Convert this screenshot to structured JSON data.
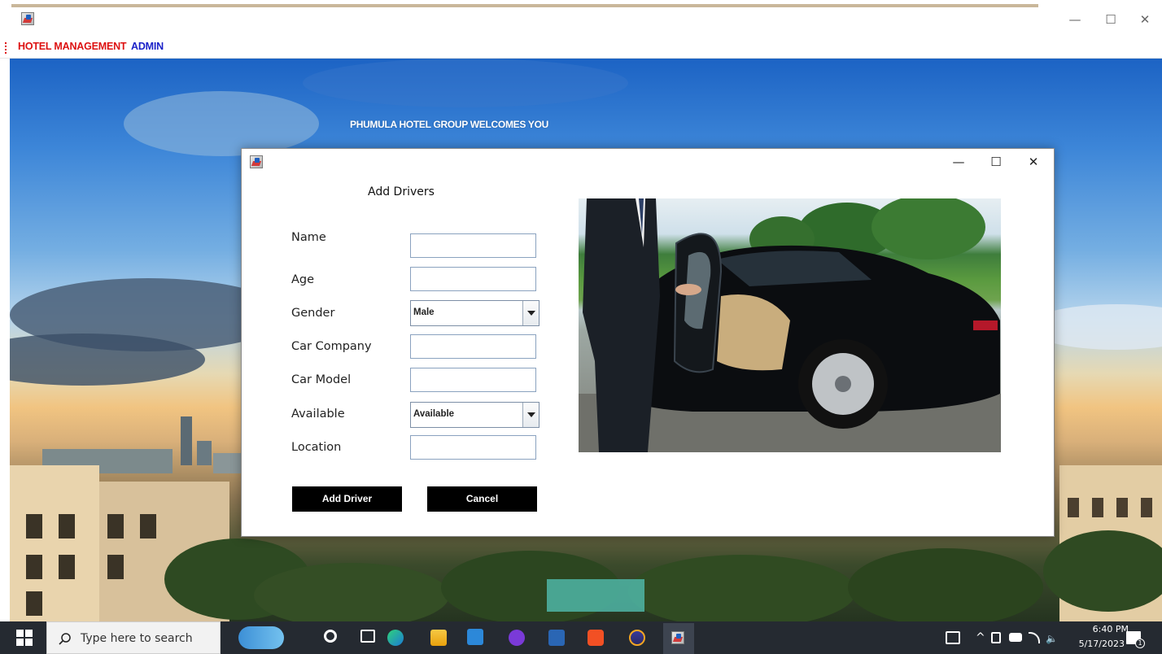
{
  "menubar": {
    "hotel_management": "HOTEL MANAGEMENT",
    "admin": "ADMIN"
  },
  "main": {
    "welcome": "PHUMULA HOTEL GROUP WELCOMES YOU"
  },
  "dialog": {
    "title": "Add Drivers",
    "fields": [
      {
        "label": "Name",
        "value": ""
      },
      {
        "label": "Age",
        "value": ""
      },
      {
        "label": "Gender",
        "value": "Male"
      },
      {
        "label": "Car Company",
        "value": ""
      },
      {
        "label": "Car Model",
        "value": ""
      },
      {
        "label": "Available",
        "value": "Available"
      },
      {
        "label": "Location",
        "value": ""
      }
    ],
    "buttons": {
      "add": "Add Driver",
      "cancel": "Cancel"
    }
  },
  "taskbar": {
    "search_placeholder": "Type here to search",
    "time": "6:40 PM",
    "date": "5/17/2023",
    "notification_count": "1"
  },
  "icons": [
    "app-icon",
    "minimize-icon",
    "maximize-icon",
    "close-icon",
    "windows-start-icon",
    "search-icon",
    "task-view-icon",
    "edge-icon",
    "file-explorer-icon",
    "store-icon",
    "github-icon",
    "brave-icon",
    "eclipse-icon",
    "java-app-icon",
    "notification-icon"
  ]
}
